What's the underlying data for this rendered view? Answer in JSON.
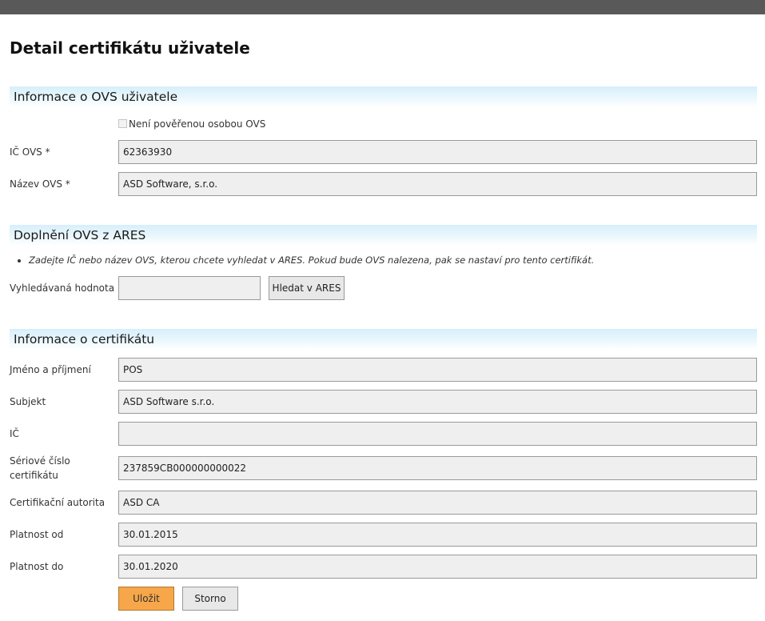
{
  "page": {
    "title": "Detail certifikátu uživatele"
  },
  "ovs_section": {
    "heading": "Informace o OVS uživatele",
    "checkbox_label": "Není pověřenou osobou OVS",
    "checkbox_checked": false,
    "ic_label": "IČ OVS *",
    "ic_value": "62363930",
    "name_label": "Název OVS *",
    "name_value": "ASD Software, s.r.o."
  },
  "ares_section": {
    "heading": "Doplnění OVS z ARES",
    "note": "Zadejte IČ nebo název OVS, kterou chcete vyhledat v ARES. Pokud bude OVS nalezena, pak se nastaví pro tento certifikát.",
    "search_label": "Vyhledávaná hodnota",
    "search_value": "",
    "search_button": "Hledat v ARES"
  },
  "cert_section": {
    "heading": "Informace o certifikátu",
    "fields": [
      {
        "label": "Jméno a příjmení",
        "value": "POS"
      },
      {
        "label": "Subjekt",
        "value": "ASD Software s.r.o."
      },
      {
        "label": "IČ",
        "value": ""
      },
      {
        "label": "Sériové číslo certifikátu",
        "value": "237859CB000000000022"
      },
      {
        "label": "Certifikační autorita",
        "value": "ASD CA"
      },
      {
        "label": "Platnost od",
        "value": "30.01.2015"
      },
      {
        "label": "Platnost do",
        "value": "30.01.2020"
      }
    ]
  },
  "actions": {
    "save": "Uložit",
    "cancel": "Storno"
  },
  "colors": {
    "topbar": "#595959",
    "section_gradient": "#d7effb",
    "save_button": "#f7a64a"
  }
}
